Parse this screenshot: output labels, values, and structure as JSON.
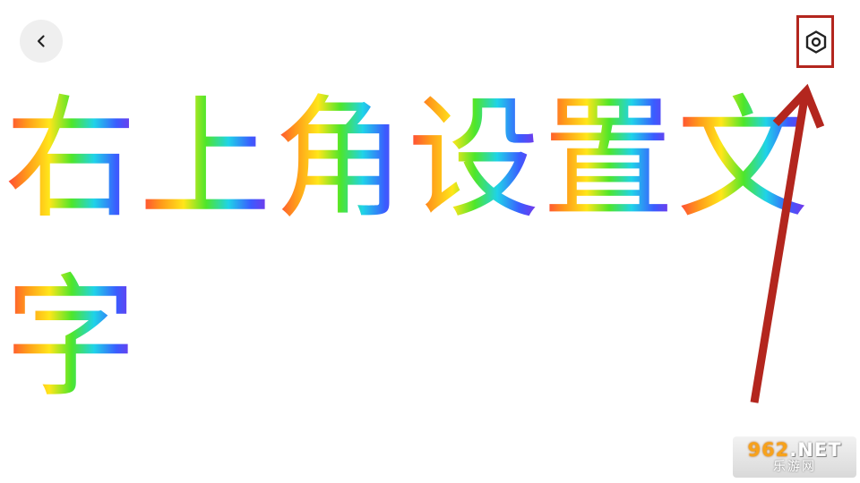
{
  "display": {
    "text": "右上角设置文字",
    "gradient": [
      "#ff3b3b",
      "#ff9a1a",
      "#ffe61a",
      "#4ee62a",
      "#1fd3e8",
      "#3a5cff",
      "#8a2be2"
    ]
  },
  "controls": {
    "back_icon": "chevron-left-icon",
    "settings_icon": "hex-gear-icon"
  },
  "annotation": {
    "highlight_color": "#b3261e",
    "arrow_color": "#b3261e"
  },
  "watermark": {
    "number": "962",
    "suffix": ".NET",
    "name": "乐游网"
  }
}
